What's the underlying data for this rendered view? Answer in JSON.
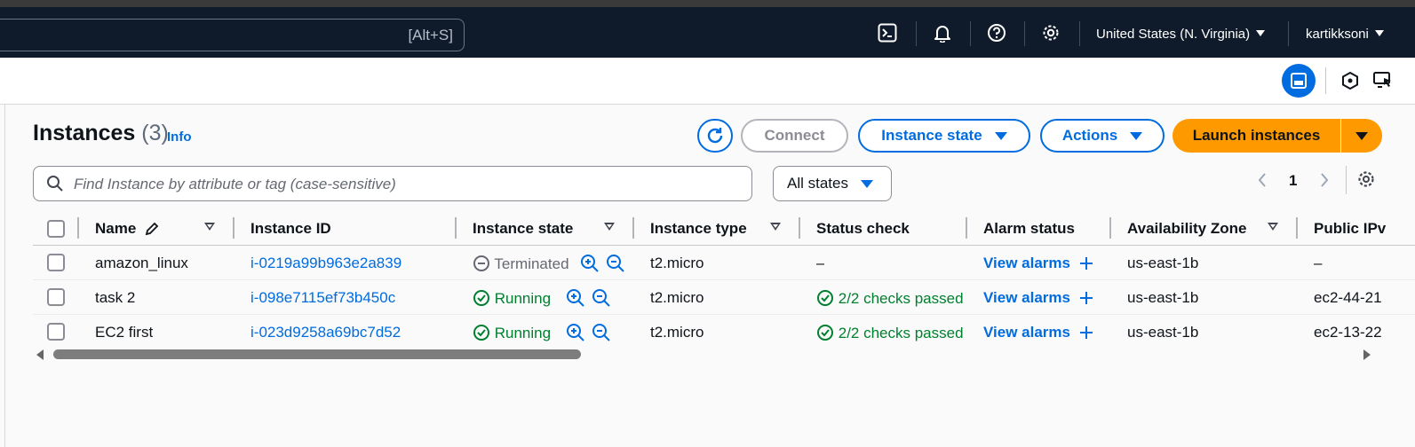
{
  "topnav": {
    "search_shortcut": "[Alt+S]",
    "region": "United States (N. Virginia)",
    "user": "kartikksoni"
  },
  "header": {
    "title": "Instances",
    "count": "(3)",
    "info": "Info",
    "connect": "Connect",
    "instance_state": "Instance state",
    "actions": "Actions",
    "launch": "Launch instances"
  },
  "filter": {
    "placeholder": "Find Instance by attribute or tag (case-sensitive)",
    "states": "All states",
    "page": "1"
  },
  "table": {
    "columns": [
      "Name",
      "Instance ID",
      "Instance state",
      "Instance type",
      "Status check",
      "Alarm status",
      "Availability Zone",
      "Public IPv"
    ],
    "rows": [
      {
        "name": "amazon_linux",
        "id": "i-0219a99b963e2a839",
        "state": "Terminated",
        "type": "t2.micro",
        "status": "–",
        "alarm": "View alarms",
        "az": "us-east-1b",
        "ip": "–"
      },
      {
        "name": "task 2",
        "id": "i-098e7115ef73b450c",
        "state": "Running",
        "type": "t2.micro",
        "status": "2/2 checks passed",
        "alarm": "View alarms",
        "az": "us-east-1b",
        "ip": "ec2-44-21"
      },
      {
        "name": "EC2 first",
        "id": "i-023d9258a69bc7d52",
        "state": "Running",
        "type": "t2.micro",
        "status": "2/2 checks passed",
        "alarm": "View alarms",
        "az": "us-east-1b",
        "ip": "ec2-13-22"
      }
    ]
  },
  "colors": {
    "accent": "#006ce0",
    "launch": "#ff9900",
    "success": "#00802f",
    "nav": "#0f1b2a"
  }
}
